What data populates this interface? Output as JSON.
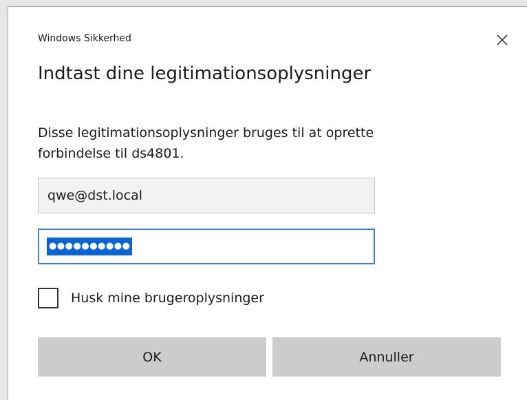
{
  "window": {
    "title": "Windows Sikkerhed",
    "close_icon": "close-icon"
  },
  "dialog": {
    "heading": "Indtast dine legitimationsoplysninger",
    "description": "Disse legitimationsoplysninger bruges til at oprette forbindelse til ds4801."
  },
  "form": {
    "username_value": "qwe@dst.local",
    "password_masked": "●●●●●●●●●●",
    "remember_label": "Husk mine brugeroplysninger",
    "remember_checked": false
  },
  "buttons": {
    "ok_label": "OK",
    "cancel_label": "Annuller"
  },
  "colors": {
    "focus_border": "#3d7fd0",
    "selection": "#0a64d6",
    "button_bg": "#cccccc",
    "input_bg": "#f2f2f2"
  }
}
